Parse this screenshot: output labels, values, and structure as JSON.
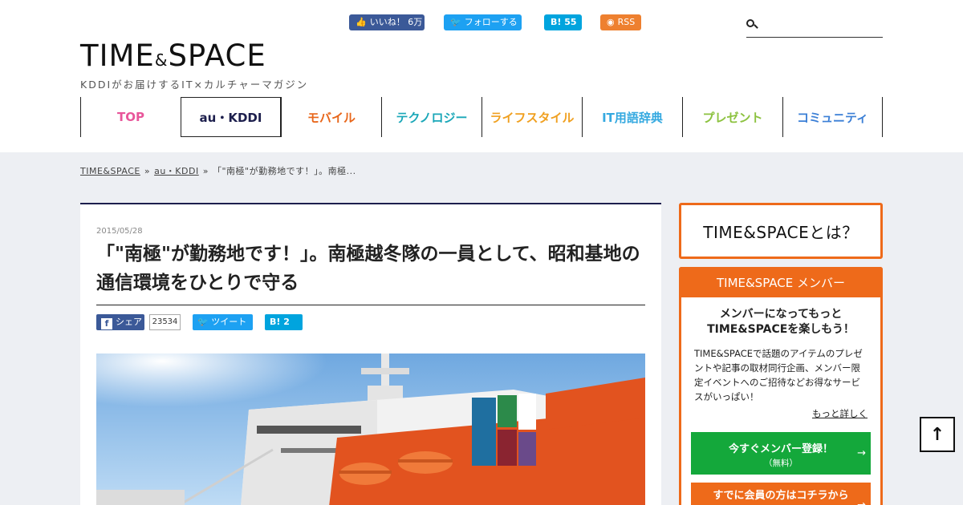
{
  "header": {
    "logo_main": "TIME",
    "logo_amp": "&",
    "logo_tail": "SPACE",
    "logo_sub": "KDDIがお届けするIT×カルチャーマガジン",
    "social": {
      "facebook_label": "いいね！ 6万",
      "twitter_label": "フォローする",
      "hatena_label": "B! 55",
      "rss_label": "RSS"
    },
    "search": {
      "placeholder": ""
    }
  },
  "nav": {
    "items": [
      {
        "label": "TOP",
        "color": "#e8569a"
      },
      {
        "label": "au・KDDI",
        "color": "#1d1f4d"
      },
      {
        "label": "モバイル",
        "color": "#e8661a"
      },
      {
        "label": "テクノロジー",
        "color": "#1aa7b8"
      },
      {
        "label": "ライフスタイル",
        "color": "#f0a020"
      },
      {
        "label": "IT用語辞典",
        "color": "#35a9e0"
      },
      {
        "label": "プレゼント",
        "color": "#8cc23f"
      },
      {
        "label": "コミュニティ",
        "color": "#3b7fd6"
      }
    ]
  },
  "breadcrumb": {
    "home": "TIME&SPACE",
    "category": "au・KDDI",
    "current": "「\"南極\"が勤務地です！」。南極...",
    "sep": "»"
  },
  "article": {
    "date": "2015/05/28",
    "title": "「\"南極\"が勤務地です！」。南極越冬隊の一員として、昭和基地の通信環境をひとりで守る",
    "share": {
      "facebook_label": "シェア",
      "facebook_count": "23534",
      "twitter_label": "ツイート",
      "hatena_label": "B! 2"
    }
  },
  "sidebar": {
    "about_label": "TIME&SPACEとは？",
    "member": {
      "header": "TIME&SPACE メンバー",
      "lead_line1": "メンバーになってもっと",
      "lead_line2": "TIME&SPACEを楽しもう！",
      "description": "TIME&SPACEで話題のアイテムのプレゼントや記事の取材同行企画、メンバー限定イベントへのご招待などお得なサービスがいっぱい！",
      "more_link": "もっと詳しく",
      "register_label": "今すぐメンバー登録！",
      "register_sub": "（無料）",
      "login_label": "すでに会員の方はコチラから",
      "arrow": "→"
    }
  },
  "page_top_label": "↑",
  "colors": {
    "accent_orange": "#ee6a1a",
    "navy": "#1d1f4d",
    "register_green": "#14a83b",
    "background_gray": "#edeff3"
  }
}
